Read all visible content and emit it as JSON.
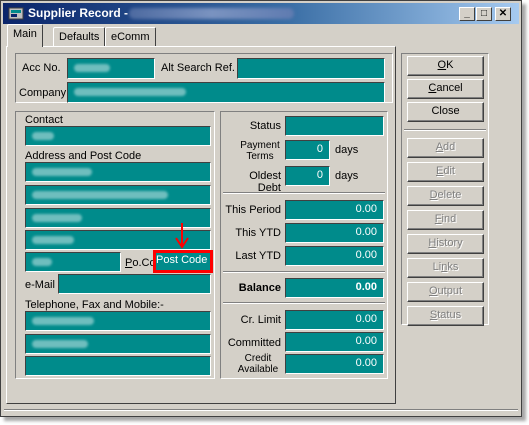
{
  "window": {
    "title": "Supplier Record -",
    "controls": {
      "minimize": "_",
      "maximize": "□",
      "close": "✕"
    }
  },
  "tabs": [
    {
      "label": "Main"
    },
    {
      "label": "Defaults"
    },
    {
      "label": "eComm"
    }
  ],
  "header": {
    "acc_no_label": "Acc No.",
    "alt_search_label": "Alt Search Ref.",
    "company_label": "Company"
  },
  "contact_panel": {
    "contact_label": "Contact",
    "address_label": "Address and Post Code",
    "po_code_label": "Po.Co",
    "post_code_value": "Post Code",
    "email_label": "e-Mail",
    "phone_label": "Telephone, Fax and Mobile:-"
  },
  "status_panel": {
    "status_label": "Status",
    "payment_terms_label_1": "Payment",
    "payment_terms_label_2": "Terms",
    "payment_terms_value": "0",
    "payment_terms_unit": "days",
    "oldest_debt_label": "Oldest Debt",
    "oldest_debt_value": "0",
    "oldest_debt_unit": "days"
  },
  "totals": {
    "this_period_label": "This Period",
    "this_period_value": "0.00",
    "this_ytd_label": "This YTD",
    "this_ytd_value": "0.00",
    "last_ytd_label": "Last YTD",
    "last_ytd_value": "0.00",
    "balance_label": "Balance",
    "balance_value": "0.00",
    "cr_limit_label": "Cr. Limit",
    "cr_limit_value": "0.00",
    "committed_label": "Committed",
    "committed_value": "0.00",
    "credit_available_label_1": "Credit",
    "credit_available_label_2": "Available",
    "credit_available_value": "0.00"
  },
  "buttons": {
    "ok": {
      "underlined": "O",
      "rest": "K"
    },
    "cancel": {
      "underlined": "C",
      "rest": "ancel"
    },
    "close": {
      "label": "Close"
    },
    "add": {
      "underlined": "A",
      "rest": "dd"
    },
    "edit": {
      "underlined": "E",
      "rest": "dit"
    },
    "delete": {
      "underlined": "D",
      "rest": "elete"
    },
    "find": {
      "underlined": "F",
      "rest": "ind"
    },
    "history": {
      "underlined": "H",
      "rest": "istory"
    },
    "links": {
      "pre": "Li",
      "underlined": "n",
      "rest": "ks"
    },
    "output": {
      "underlined": "O",
      "rest": "utput"
    },
    "status": {
      "underlined": "S",
      "rest": "tatus"
    }
  },
  "colors": {
    "field": "#008b8b",
    "highlight": "#ff0000",
    "titlebar": "#0a246a"
  }
}
